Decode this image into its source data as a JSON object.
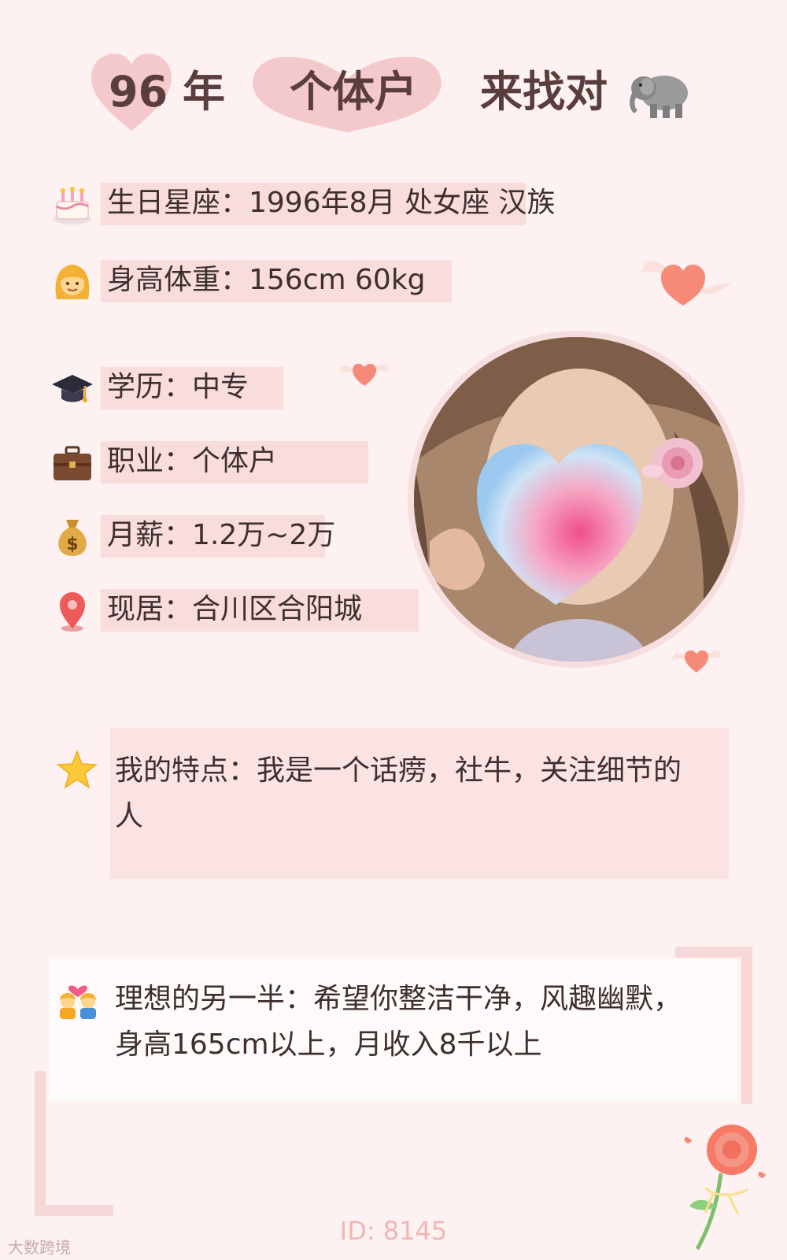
{
  "header": {
    "year": "96",
    "year_suffix": "年",
    "occupation": "个体户",
    "seeking": "来找对"
  },
  "info": [
    {
      "icon": "cake-icon",
      "label": "生日星座：1996年8月 处女座 汉族"
    },
    {
      "icon": "woman-icon",
      "label": "身高体重：156cm 60kg"
    },
    {
      "icon": "graduation-cap-icon",
      "label": "学历：中专"
    },
    {
      "icon": "briefcase-icon",
      "label": "职业：个体户"
    },
    {
      "icon": "money-bag-icon",
      "label": "月薪：1.2万~2万"
    },
    {
      "icon": "location-pin-icon",
      "label": "现居：合川区合阳城"
    }
  ],
  "traits": {
    "icon": "star-icon",
    "line1": "我的特点：我是一个话痨，社牛，关注细节的",
    "line2": "人"
  },
  "ideal": {
    "icon": "couple-heart-icon",
    "line1": "理想的另一半：希望你整洁干净，风趣幽默，",
    "line2": "身高165cm以上，月收入8千以上"
  },
  "footer": {
    "id_label": "ID: 8145",
    "watermark": "大数跨境"
  },
  "colors": {
    "background": "#fdf1f1",
    "row_highlight": "#f9dcdc",
    "heart_badge": "#f4c9cb",
    "title_text": "#5a3d3d"
  }
}
